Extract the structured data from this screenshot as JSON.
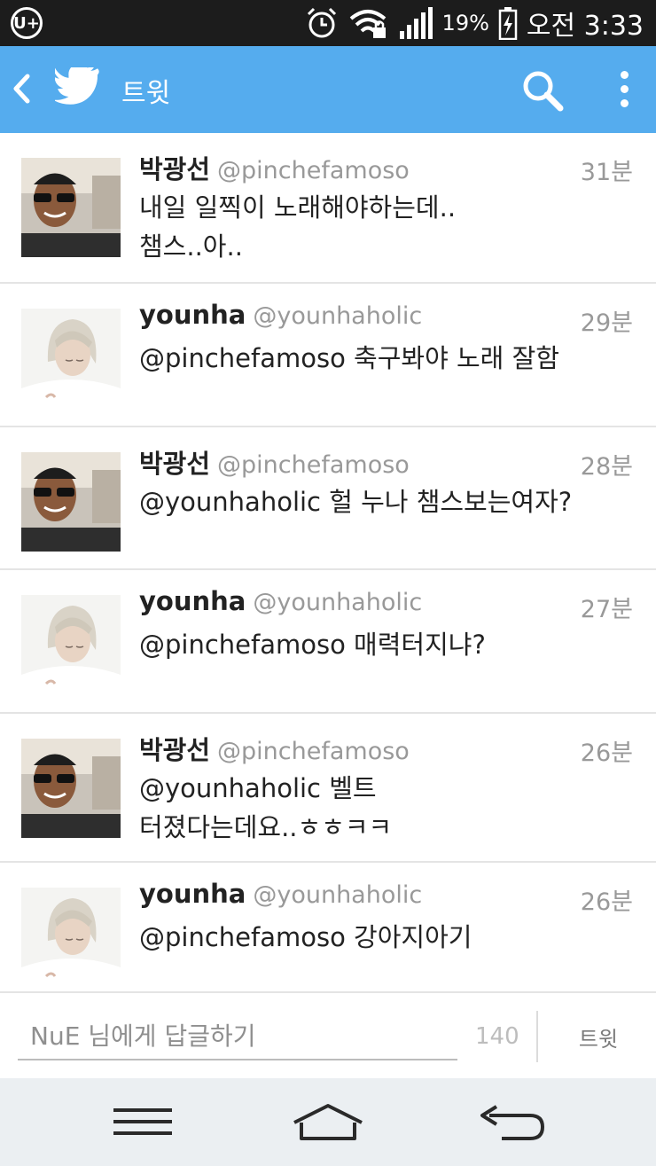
{
  "status": {
    "carrier": "U+",
    "battery": "19%",
    "time": "오전 3:33"
  },
  "appbar": {
    "title": "트윗"
  },
  "tweets": [
    {
      "name": "박광선",
      "handle": "@pinchefamoso",
      "time": "31분",
      "text": "내일 일찍이 노래해야하는데..\n챔스..아..",
      "avatar": "man-sunglasses"
    },
    {
      "name": "younha",
      "handle": "@younhaholic",
      "time": "29분",
      "text": "@pinchefamoso 축구봐야 노래 잘함",
      "avatar": "woman-blonde"
    },
    {
      "name": "박광선",
      "handle": "@pinchefamoso",
      "time": "28분",
      "text": "@younhaholic 헐 누나 챔스보는여자?",
      "avatar": "man-sunglasses"
    },
    {
      "name": "younha",
      "handle": "@younhaholic",
      "time": "27분",
      "text": "@pinchefamoso 매력터지냐?",
      "avatar": "woman-blonde"
    },
    {
      "name": "박광선",
      "handle": "@pinchefamoso",
      "time": "26분",
      "text": "@younhaholic 벨트\n터졌다는데요..ㅎㅎㅋㅋ",
      "avatar": "man-sunglasses"
    },
    {
      "name": "younha",
      "handle": "@younhaholic",
      "time": "26분",
      "text": "@pinchefamoso 강아지아기",
      "avatar": "woman-blonde"
    }
  ],
  "reply": {
    "placeholder": "NuE 님에게 답글하기",
    "counter": "140",
    "button_label": "트윗"
  },
  "colors": {
    "accent": "#55acee",
    "statusbar": "#1c1c1c",
    "navbar": "#ebeff2"
  },
  "icons": {
    "back": "chevron-left-icon",
    "logo": "twitter-bird-icon",
    "search": "search-icon",
    "more": "overflow-menu-icon"
  }
}
